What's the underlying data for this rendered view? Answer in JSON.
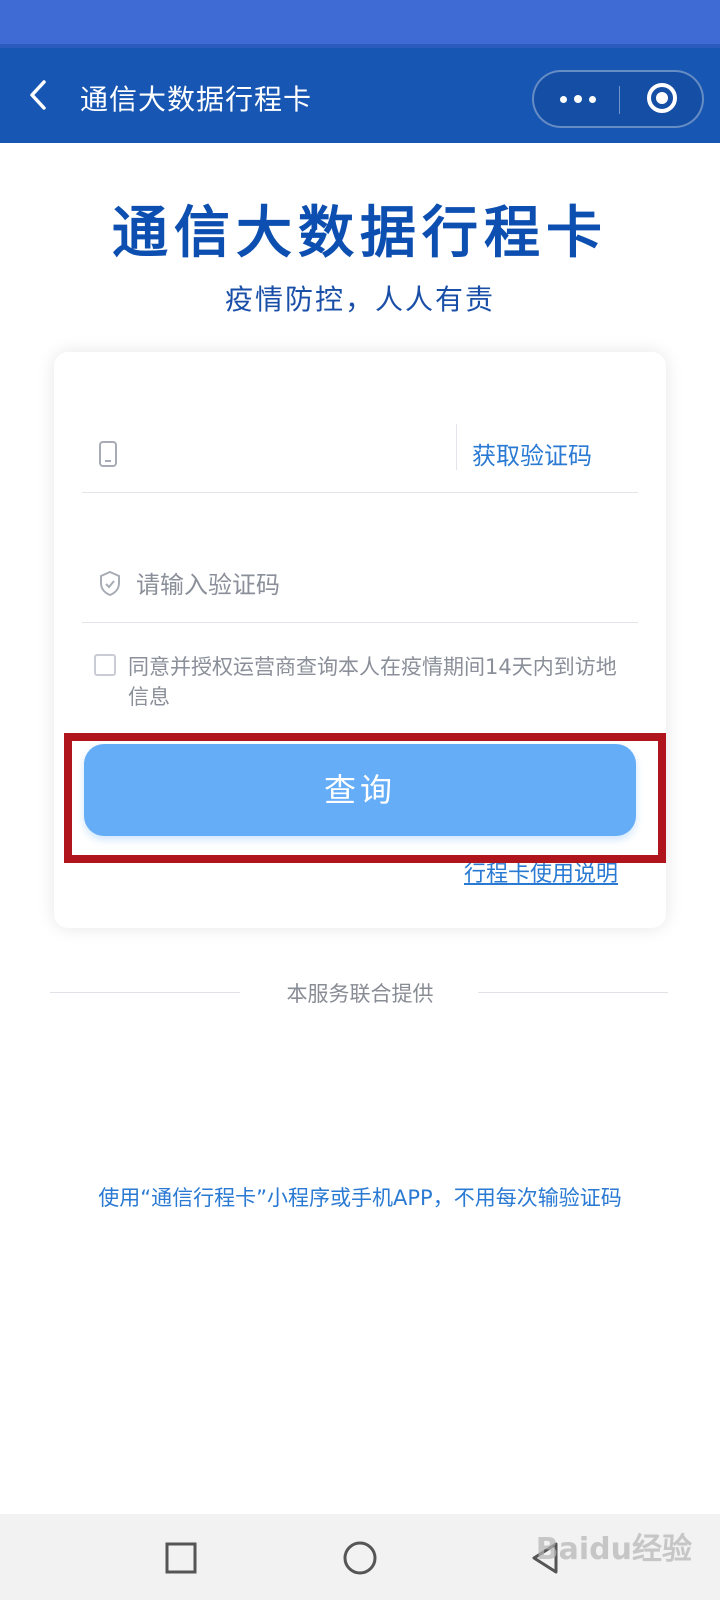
{
  "header": {
    "title": "通信大数据行程卡",
    "back_icon": "chevron-left-icon",
    "more_icon": "more-dots-icon",
    "close_icon": "target-close-icon"
  },
  "main": {
    "title": "通信大数据行程卡",
    "subtitle": "疫情防控，人人有责"
  },
  "form": {
    "phone": {
      "value": "",
      "placeholder": "",
      "icon": "phone-icon"
    },
    "get_code_label": "获取验证码",
    "code": {
      "value": "",
      "placeholder": "请输入验证码",
      "icon": "shield-check-icon"
    },
    "consent_checked": false,
    "consent_text": "同意并授权运营商查询本人在疫情期间14天内到访地信息",
    "query_button": "查询",
    "guide_link": "行程卡使用说明"
  },
  "footer": {
    "provider_text": "本服务联合提供",
    "promo_text": "使用“通信行程卡”小程序或手机APP，不用每次输验证码"
  },
  "watermark": "Baidu经验",
  "colors": {
    "header_bg": "#1756b3",
    "title_blue": "#0d4fb0",
    "link_blue": "#2a7ad3",
    "button_bg": "#66adf8",
    "highlight": "#b0141c"
  }
}
